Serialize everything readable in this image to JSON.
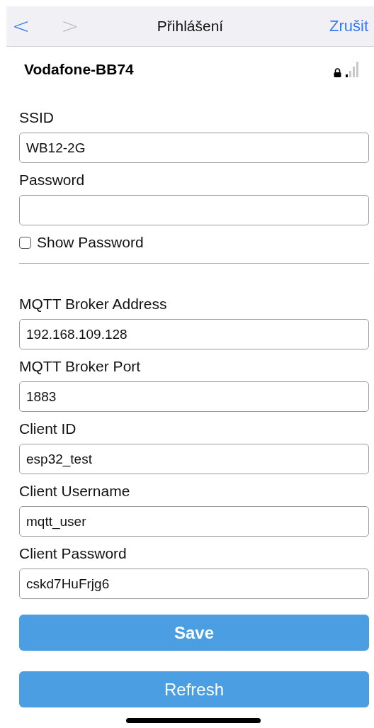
{
  "nav_bar": {
    "back": {
      "glyph": "<",
      "disabled": false
    },
    "forward": {
      "glyph": ">",
      "disabled": true
    },
    "title": "Přihlášení",
    "cancel": "Zrušit"
  },
  "network": {
    "name": "Vodafone-BB74",
    "locked": true
  },
  "wifi_fields": [
    {
      "label": "SSID",
      "value": "WB12-2G"
    },
    {
      "label": "Password"
    }
  ],
  "show_password": {
    "label": "Show Password",
    "checked": false
  },
  "mqtt_fields": [
    {
      "label": "MQTT Broker Address",
      "value": "192.168.109.128"
    },
    {
      "label": "MQTT Broker Port",
      "value": "1883"
    },
    {
      "label": "Client ID",
      "value": "esp32_test"
    },
    {
      "label": "Client Username",
      "value": "mqtt_user"
    },
    {
      "label": "Client Password",
      "value": "cskd7HuFrjg6"
    }
  ],
  "buttons": [
    {
      "label": "Save",
      "emphasis": true
    },
    {
      "label": "Refresh",
      "emphasis": false
    }
  ]
}
